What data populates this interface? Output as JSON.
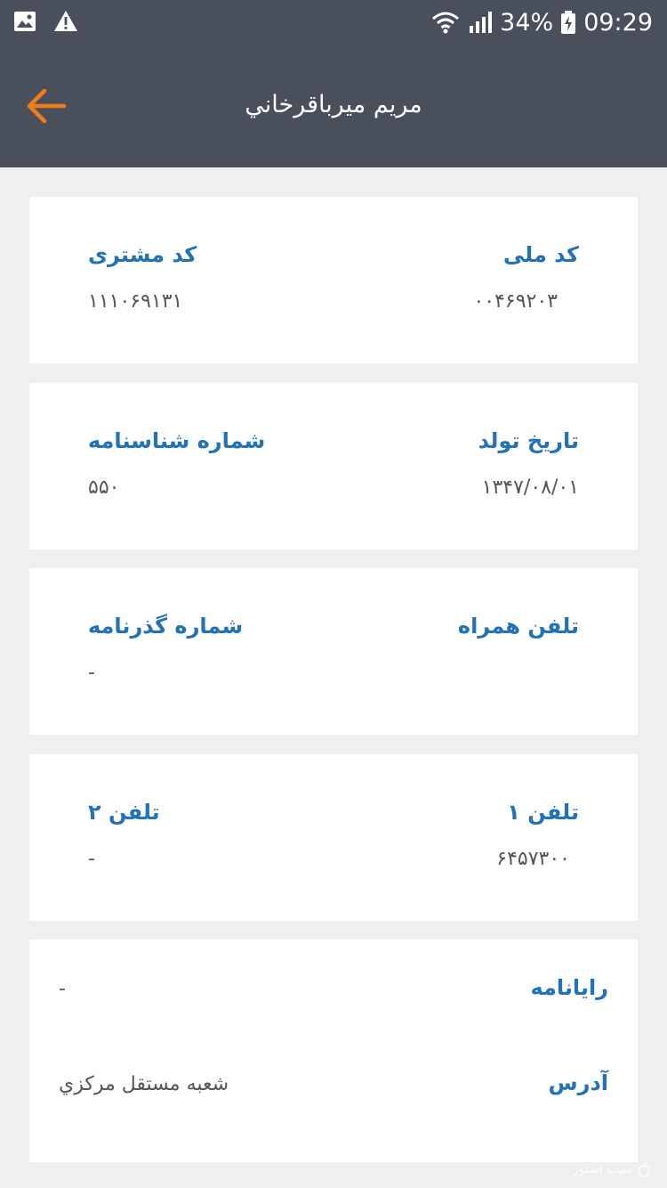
{
  "status_bar": {
    "battery": "34%",
    "time": "09:29",
    "icons": [
      "gallery-icon",
      "warning-icon",
      "wifi-icon",
      "signal-icon",
      "battery-icon"
    ]
  },
  "header": {
    "title": "مریم میرباقرخاني",
    "back_icon": "arrow-left-icon",
    "accent": "#f07d1a",
    "bar_color": "#4a4f5c"
  },
  "cards": [
    {
      "right": {
        "label": "کد ملی",
        "value": "۰۰۴۶۹۲۰۳"
      },
      "left": {
        "label": "کد مشتری",
        "value": "۱۱۱۰۶۹۱۳۱"
      }
    },
    {
      "right": {
        "label": "تاریخ تولد",
        "value": "۱۳۴۷/۰۸/۰۱"
      },
      "left": {
        "label": "شماره شناسنامه",
        "value": "۵۵۰"
      }
    },
    {
      "right": {
        "label": "تلفن همراه",
        "value": ""
      },
      "left": {
        "label": "شماره گذرنامه",
        "value": "-"
      }
    },
    {
      "right": {
        "label": "تلفن ۱",
        "value": "۶۴۵۷۳۰۰"
      },
      "left": {
        "label": "تلفن ۲",
        "value": "-"
      }
    }
  ],
  "details": {
    "email_label": "رایانامه",
    "email_value": "-",
    "address_label": "آدرس",
    "address_value": "شعبه مستقل مرکزي"
  },
  "watermark": "سیب اسنور",
  "label_color": "#2172b9"
}
